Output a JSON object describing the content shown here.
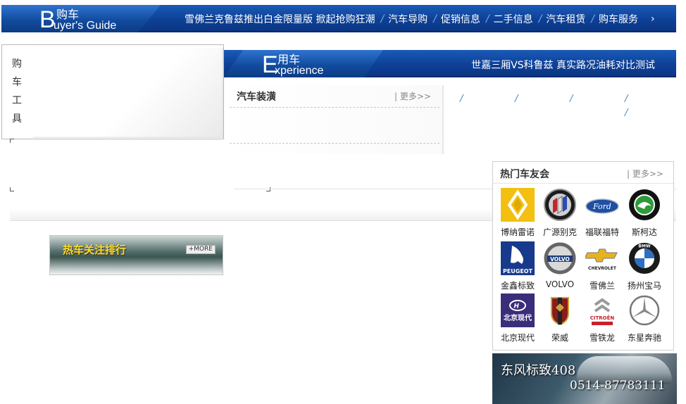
{
  "header": {
    "logo": {
      "big_letter": "B",
      "cn": "购车",
      "en": "uyer's Guide"
    },
    "nav": [
      {
        "label": "雪佛兰克鲁兹推出白金限量版  掀起抢购狂潮"
      },
      {
        "label": "汽车导购"
      },
      {
        "label": "促销信息"
      },
      {
        "label": "二手信息"
      },
      {
        "label": "汽车租赁"
      },
      {
        "label": "购车服务"
      }
    ],
    "nav_arrow": "›"
  },
  "tools": {
    "label": "购车工具"
  },
  "experience": {
    "logo": {
      "big_letter": "E",
      "cn": "用车",
      "en": "xperience"
    },
    "headline": "世嘉三厢VS科鲁兹  真实路况油耗对比测试"
  },
  "decoration": {
    "title": "汽车装潢",
    "more": "更多>>"
  },
  "ranking": {
    "title": "热车关注排行",
    "more": "+MORE"
  },
  "clubs": {
    "title": "热门车友会",
    "more": "更多>>",
    "brands": [
      {
        "name": "博纳雷诺",
        "icon": "renault-logo-icon"
      },
      {
        "name": "广源别克",
        "icon": "buick-logo-icon"
      },
      {
        "name": "福联福特",
        "icon": "ford-logo-icon"
      },
      {
        "name": "斯柯达",
        "icon": "skoda-logo-icon"
      },
      {
        "name": "金鑫标致",
        "icon": "peugeot-logo-icon",
        "logo_text": "PEUGEOT"
      },
      {
        "name": "VOLVO",
        "icon": "volvo-logo-icon",
        "logo_text": "VOLVO"
      },
      {
        "name": "雪佛兰",
        "icon": "chevrolet-logo-icon",
        "logo_text": "CHEVROLET"
      },
      {
        "name": "扬州宝马",
        "icon": "bmw-logo-icon",
        "logo_text": "BMW"
      },
      {
        "name": "北京现代",
        "icon": "hyundai-logo-icon",
        "logo_text": "北京现代"
      },
      {
        "name": "荣威",
        "icon": "roewe-logo-icon"
      },
      {
        "name": "雪铁龙",
        "icon": "citroen-logo-icon",
        "logo_text": "CITROËN"
      },
      {
        "name": "东星奔驰",
        "icon": "mercedes-logo-icon"
      }
    ]
  },
  "ad": {
    "title": "东风标致408",
    "phone": "0514-87783111"
  }
}
